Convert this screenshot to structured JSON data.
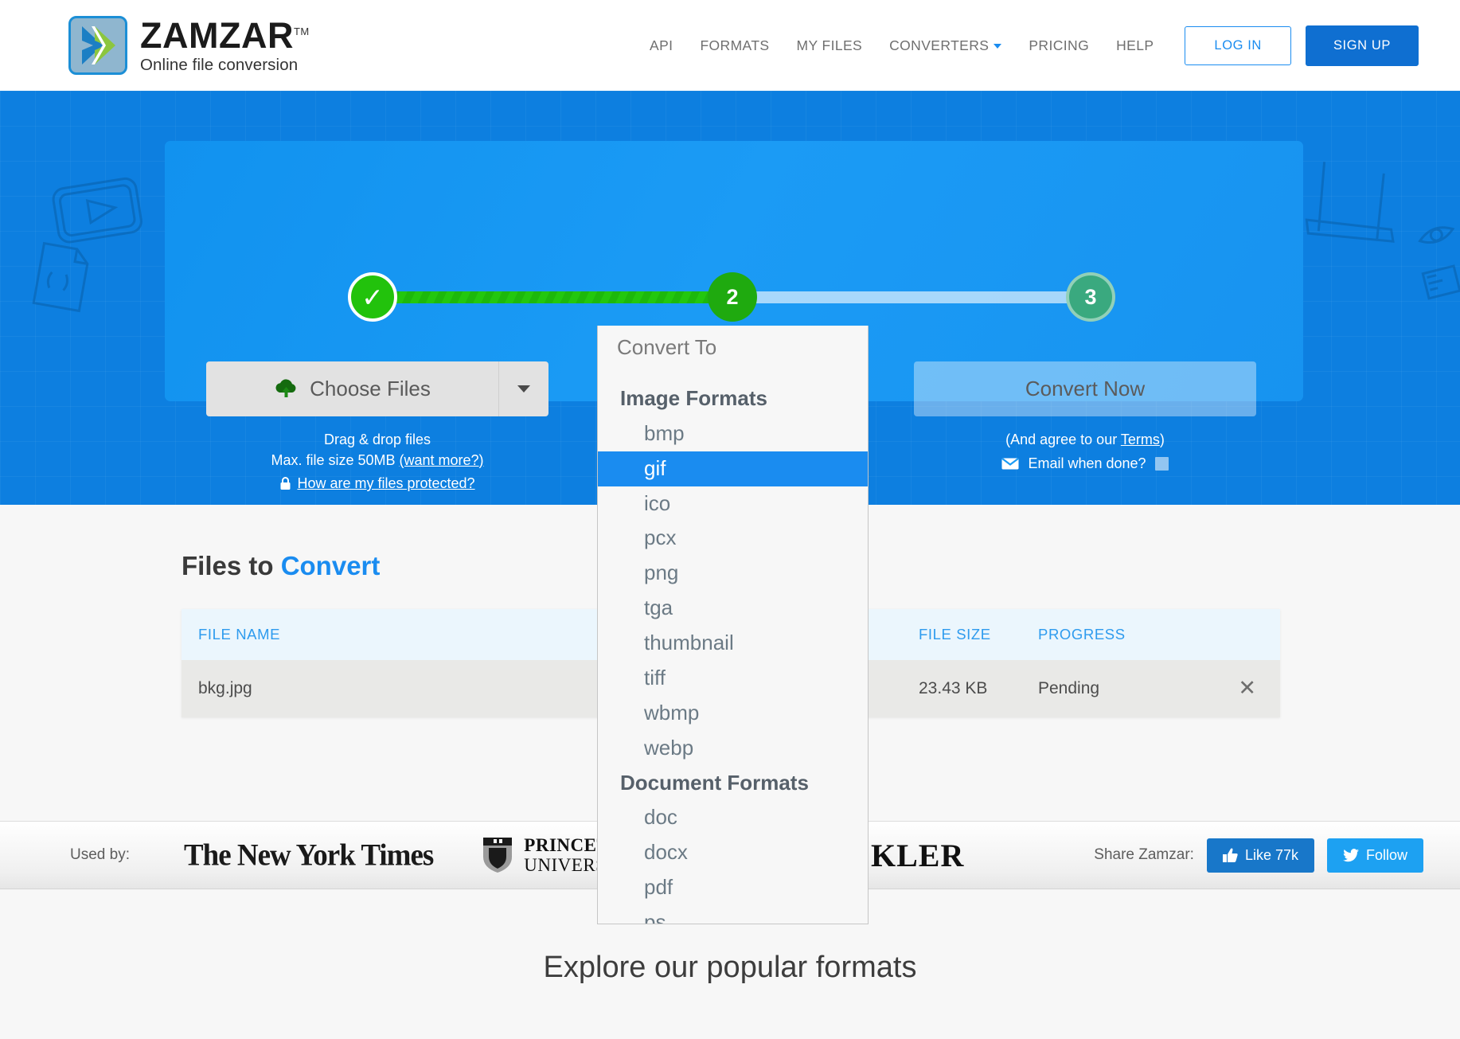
{
  "header": {
    "logo": {
      "title": "ZAMZAR",
      "tm": "TM",
      "subtitle": "Online file conversion"
    },
    "nav": [
      {
        "label": "API",
        "caret": false
      },
      {
        "label": "FORMATS",
        "caret": false
      },
      {
        "label": "MY FILES",
        "caret": false
      },
      {
        "label": "CONVERTERS",
        "caret": true
      },
      {
        "label": "PRICING",
        "caret": false
      },
      {
        "label": "HELP",
        "caret": false
      }
    ],
    "login_label": "LOG IN",
    "signup_label": "SIGN UP"
  },
  "hero": {
    "steps": [
      {
        "label": "✓",
        "state": "done"
      },
      {
        "label": "2",
        "state": "active"
      },
      {
        "label": "3",
        "state": "todo"
      }
    ],
    "step1": {
      "button_label": "Choose Files",
      "icon": "cloud-upload-icon",
      "note_line1": "Drag & drop files",
      "note_line2_prefix": "Max. file size 50MB ",
      "note_line2_link": "(want more?)",
      "protected_link": "How are my files protected?",
      "lock_icon": "lock-icon"
    },
    "step2": {
      "button_label": "Convert To",
      "dropdown": {
        "placeholder": "Convert To",
        "selected": "gif",
        "groups": [
          {
            "title": "Image Formats",
            "items": [
              "bmp",
              "gif",
              "ico",
              "pcx",
              "png",
              "tga",
              "thumbnail",
              "tiff",
              "wbmp",
              "webp"
            ]
          },
          {
            "title": "Document Formats",
            "items": [
              "doc",
              "docx",
              "pdf",
              "ps"
            ]
          }
        ]
      }
    },
    "step3": {
      "button_label": "Convert Now",
      "terms_prefix": "(And agree to our ",
      "terms_link": "Terms",
      "terms_suffix": ")",
      "email_label": "Email when done?",
      "email_icon": "envelope-icon",
      "email_checked": false
    }
  },
  "files": {
    "title_main": "Files to ",
    "title_accent": "Convert",
    "columns": [
      "FILE NAME",
      "FILE SIZE",
      "PROGRESS"
    ],
    "rows": [
      {
        "name": "bkg.jpg",
        "size": "23.43 KB",
        "progress": "Pending",
        "remove_icon": "close-icon"
      }
    ]
  },
  "usedby": {
    "label": "Used by:",
    "logos": [
      "The New York Times",
      "PRINCETON",
      "UNIVERSITY",
      "KLER"
    ],
    "share_label": "Share Zamzar:",
    "facebook_label": "Like 77k",
    "twitter_label": "Follow",
    "facebook_icon": "thumbs-up-icon",
    "twitter_icon": "twitter-bird-icon"
  },
  "explore": {
    "title": "Explore our popular formats"
  },
  "colors": {
    "brand_blue": "#0d7fe0",
    "accent_blue": "#1a8cf0",
    "signup_blue": "#0f6fd1",
    "step_green": "#22c20c",
    "facebook": "#1877c9",
    "twitter": "#1da1f2"
  }
}
